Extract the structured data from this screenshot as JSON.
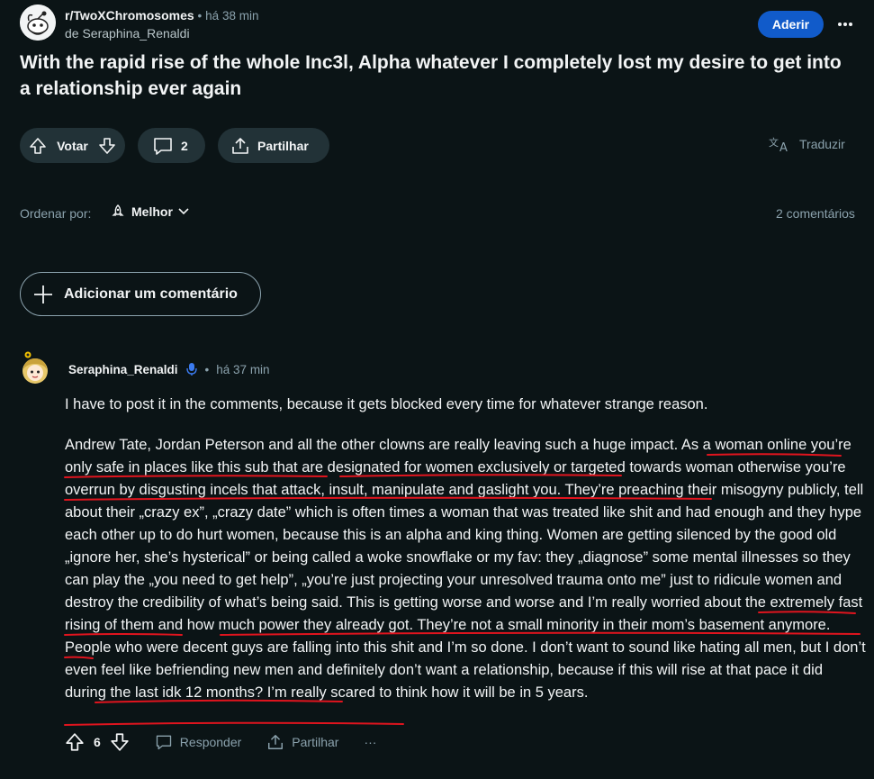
{
  "post": {
    "subreddit": "r/TwoXChromosomes",
    "separator": "•",
    "time": "há 38 min",
    "by_prefix": "de",
    "author": "Seraphina_Renaldi",
    "join_label": "Aderir",
    "title": "With the rapid rise of the whole Inc3l, Alpha whatever I completely lost my desire to get into a relationship ever again"
  },
  "actions": {
    "vote_label": "Votar",
    "comments_count": "2",
    "share_label": "Partilhar",
    "translate_label": "Traduzir"
  },
  "sort": {
    "label": "Ordenar por:",
    "value": "Melhor",
    "total_comments": "2 comentários"
  },
  "add_comment_label": "Adicionar um comentário",
  "comment": {
    "author": "Seraphina_Renaldi",
    "separator": "•",
    "time": "há 37 min",
    "paragraph1": "I have to post it in the comments, because it gets blocked every time for whatever strange reason.",
    "paragraph2": "Andrew Tate, Jordan Peterson and all the other clowns are really leaving such a huge impact. As a woman online you’re only safe in places like this sub that are designated for women exclusively or targeted towards woman otherwise you’re overrun by disgusting incels that attack, insult, manipulate and gaslight you. They’re preaching their misogyny publicly, tell about their „crazy ex”, „crazy date” which is often times a woman that was treated like shit and had enough and they hype each other up to do hurt women, because this is an alpha and king thing. Women are getting silenced by the good old „ignore her, she’s hysterical” or being called a woke snowflake or my fav: they „diagnose” some mental illnesses so they can play the „you need to get help”, „you’re just projecting your unresolved trauma onto me” just to ridicule women and destroy the credibility of what’s being said. This is getting worse and worse and I’m really worried about the extremely fast rising of them and how much power they already got. They’re not a small minority in their mom’s basement anymore. People who were decent guys are falling into this shit and I’m so done. I don’t want to sound like hating all men, but I don’t even feel like befriending new men and definitely don’t want a relationship, because if this will rise at that pace it did during the last idk 12 months? I’m really scared to think how it will be in 5 years.",
    "votes": "6",
    "reply_label": "Responder",
    "share_label": "Partilhar",
    "more_label": "···"
  },
  "icons": {
    "subreddit_avatar": "snoo-avatar-icon",
    "join": "join-button",
    "overflow": "more-horizontal-icon",
    "upvote": "upvote-arrow-icon",
    "downvote": "downvote-arrow-icon",
    "comment": "comment-bubble-icon",
    "share": "share-icon",
    "translate": "translate-icon",
    "sort": "rocket-icon",
    "chevron": "chevron-down-icon",
    "add": "plus-icon",
    "mic": "microphone-icon"
  },
  "colors": {
    "background": "#0b1416",
    "accent": "#115bca",
    "pill": "#223237",
    "muted_text": "#8ba2ad",
    "annotation_underline": "#e0141e"
  }
}
